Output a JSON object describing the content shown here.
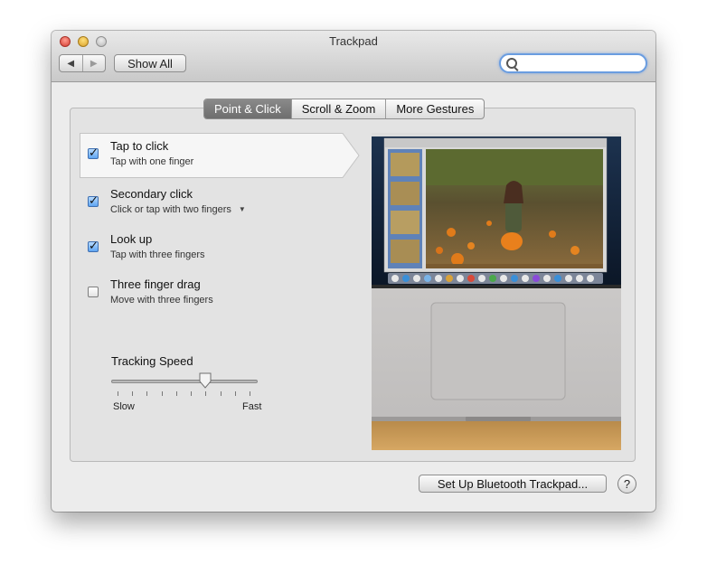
{
  "window": {
    "title": "Trackpad"
  },
  "toolbar": {
    "back_icon": "◀",
    "forward_icon": "▶",
    "show_all_label": "Show All",
    "search_placeholder": ""
  },
  "tabs": [
    {
      "label": "Point & Click",
      "active": true
    },
    {
      "label": "Scroll & Zoom",
      "active": false
    },
    {
      "label": "More Gestures",
      "active": false
    }
  ],
  "options": [
    {
      "title": "Tap to click",
      "subtitle": "Tap with one finger",
      "checked": true
    },
    {
      "title": "Secondary click",
      "subtitle": "Click or tap with two fingers",
      "checked": true
    },
    {
      "title": "Look up",
      "subtitle": "Tap with three fingers",
      "checked": true
    },
    {
      "title": "Three finger drag",
      "subtitle": "Move with three fingers",
      "checked": false
    }
  ],
  "tracking": {
    "label": "Tracking Speed",
    "slow_label": "Slow",
    "fast_label": "Fast",
    "value_fraction": 0.66,
    "tick_count": 10
  },
  "footer": {
    "bluetooth_button": "Set Up Bluetooth Trackpad...",
    "help_label": "?"
  },
  "colors": {
    "accent": "#5fa5f2",
    "selected_tab": "#777777"
  }
}
